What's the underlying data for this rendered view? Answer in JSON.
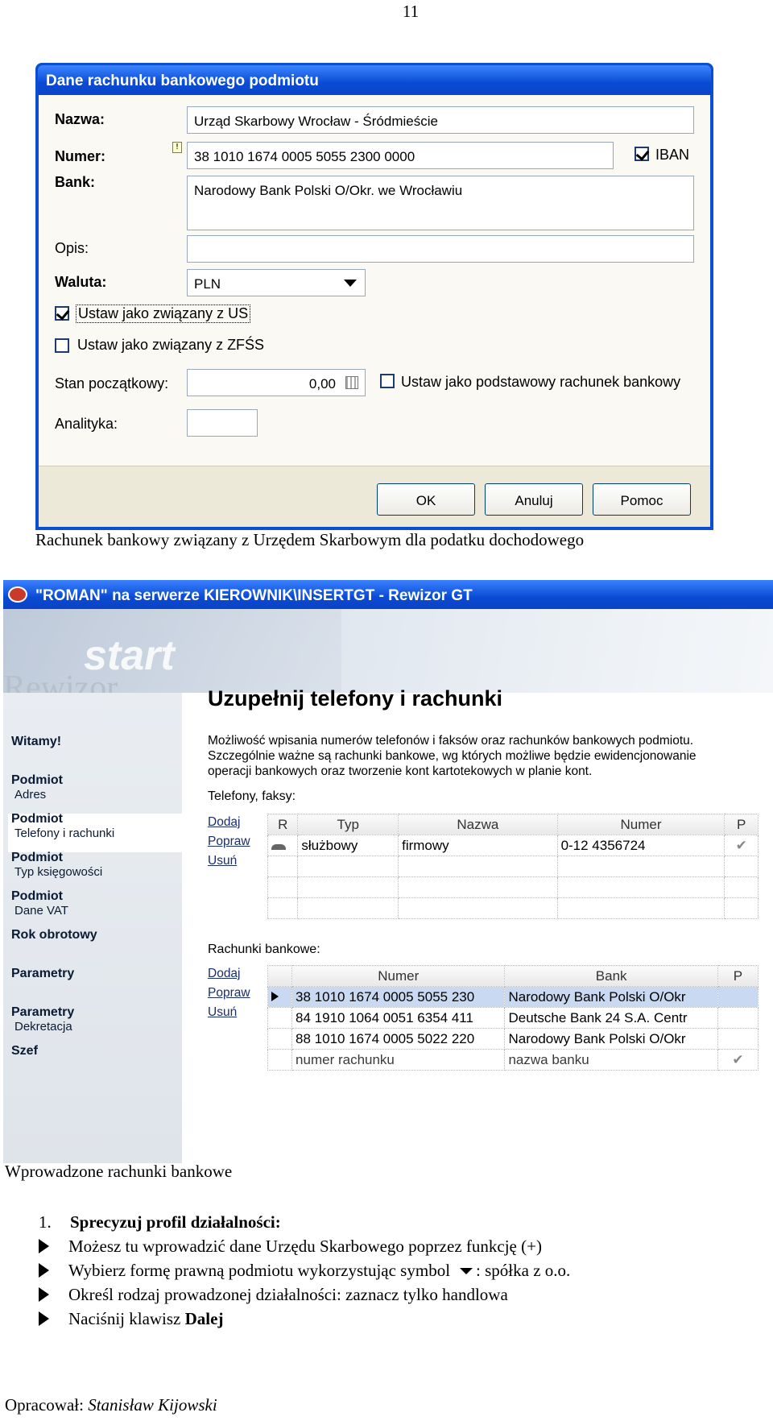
{
  "page_number": "11",
  "dialog": {
    "title": "Dane rachunku bankowego podmiotu",
    "nazwa_label": "Nazwa:",
    "nazwa_value": "Urząd Skarbowy Wrocław - Śródmieście",
    "numer_label": "Numer:",
    "numer_value": "38 1010 1674 0005 5055 2300 0000",
    "iban_label": "IBAN",
    "bank_label": "Bank:",
    "bank_value": "Narodowy Bank Polski O/Okr. we Wrocławiu",
    "opis_label": "Opis:",
    "waluta_label": "Waluta:",
    "waluta_value": "PLN",
    "us_label": "Ustaw jako związany z US",
    "zfss_label": "Ustaw jako związany z ZFŚS",
    "stan_label": "Stan początkowy:",
    "stan_value": "0,00",
    "podstawowy_label": "Ustaw jako podstawowy rachunek bankowy",
    "analityka_label": "Analityka:",
    "ok": "OK",
    "anuluj": "Anuluj",
    "pomoc": "Pomoc"
  },
  "caption1": "Rachunek bankowy związany z Urzędem Skarbowym dla podatku dochodowego",
  "app": {
    "window_title": "\"ROMAN\" na serwerze KIEROWNIK\\INSERTGT - Rewizor GT",
    "banner_word1": "start",
    "banner_word2": "Rewizor",
    "sidebar": [
      {
        "bold": "Witamy!",
        "sub": ""
      },
      {
        "bold": "Podmiot",
        "sub": "Adres"
      },
      {
        "bold": "Podmiot",
        "sub": "Telefony i rachunki"
      },
      {
        "bold": "Podmiot",
        "sub": "Typ księgowości"
      },
      {
        "bold": "Podmiot",
        "sub": "Dane VAT"
      },
      {
        "bold": "Rok obrotowy",
        "sub": ""
      },
      {
        "bold": "Parametry",
        "sub": ""
      },
      {
        "bold": "Parametry",
        "sub": "Dekretacja"
      },
      {
        "bold": "Szef",
        "sub": ""
      }
    ],
    "heading": "Uzupełnij telefony i rachunki",
    "description": "Możliwość wpisania numerów telefonów i faksów oraz rachunków bankowych podmiotu. Szczególnie ważne są rachunki bankowe, wg których możliwe będzie ewidencjonowanie operacji bankowych oraz tworzenie kont kartotekowych w planie kont.",
    "phones_label": "Telefony, faksy:",
    "accounts_label": "Rachunki bankowe:",
    "actions": {
      "dodaj": "Dodaj",
      "popraw": "Popraw",
      "usun": "Usuń"
    },
    "phones_table": {
      "headers": [
        "R",
        "Typ",
        "Nazwa",
        "Numer",
        "P"
      ],
      "rows": [
        [
          "",
          "służbowy",
          "firmowy",
          "0-12 4356724",
          ""
        ]
      ]
    },
    "accounts_table": {
      "headers": [
        "",
        "Numer",
        "Bank",
        "P"
      ],
      "rows": [
        [
          "",
          "38 1010 1674 0005 5055 230",
          "Narodowy Bank Polski O/Okr",
          ""
        ],
        [
          "",
          "84 1910 1064 0051 6354 411",
          "Deutsche Bank 24 S.A. Centr",
          ""
        ],
        [
          "",
          "88 1010 1674 0005 5022 220",
          "Narodowy Bank Polski O/Okr",
          ""
        ],
        [
          "",
          "numer rachunku",
          "nazwa banku",
          ""
        ]
      ]
    }
  },
  "caption2": "Wprowadzone rachunki bankowe",
  "list": {
    "number": "1.",
    "heading": "Sprecyzuj profil działalności:",
    "items": [
      "Możesz tu wprowadzić dane Urzędu Skarbowego poprzez funkcję (+)",
      "Wybierz formę prawną podmiotu wykorzystując symbol",
      ": spółka z o.o.",
      "Określ rodzaj prowadzonej działalności: zaznacz tylko handlowa",
      "Naciśnij klawisz ",
      "Dalej"
    ]
  },
  "footer": {
    "prefix": "Opracował: ",
    "author": "Stanisław Kijowski"
  }
}
